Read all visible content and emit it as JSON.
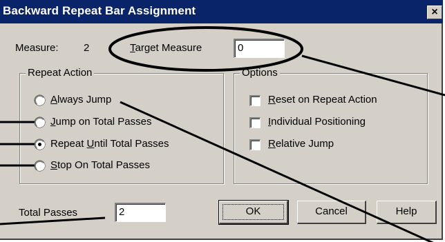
{
  "window": {
    "title": "Backward Repeat Bar Assignment",
    "close_glyph": "×"
  },
  "measure": {
    "label": "Measure:",
    "value": "2"
  },
  "target_measure": {
    "label_accel": "T",
    "label_rest": "arget Measure",
    "value": "0"
  },
  "repeat_action": {
    "title": "Repeat Action",
    "options": [
      {
        "accel": "A",
        "rest": "lways Jump",
        "selected": false
      },
      {
        "accel": "J",
        "rest": "ump on Total Passes",
        "selected": false
      },
      {
        "pre": "Repeat ",
        "accel": "U",
        "rest": "ntil Total Passes",
        "selected": true
      },
      {
        "accel": "S",
        "rest": "top On Total Passes",
        "selected": false
      }
    ]
  },
  "options": {
    "title": "Options",
    "items": [
      {
        "accel": "R",
        "rest": "eset on Repeat Action",
        "checked": false
      },
      {
        "accel": "I",
        "rest": "ndividual Positioning",
        "checked": false
      },
      {
        "accel": "R",
        "rest": "elative Jump",
        "checked": false
      }
    ]
  },
  "total_passes": {
    "label": "Total Passes",
    "value": "2"
  },
  "buttons": {
    "ok": "OK",
    "cancel": "Cancel",
    "help": "Help"
  },
  "colors": {
    "titlebar": "#0a246a",
    "face": "#d4d0c8",
    "callout": "#000000"
  }
}
